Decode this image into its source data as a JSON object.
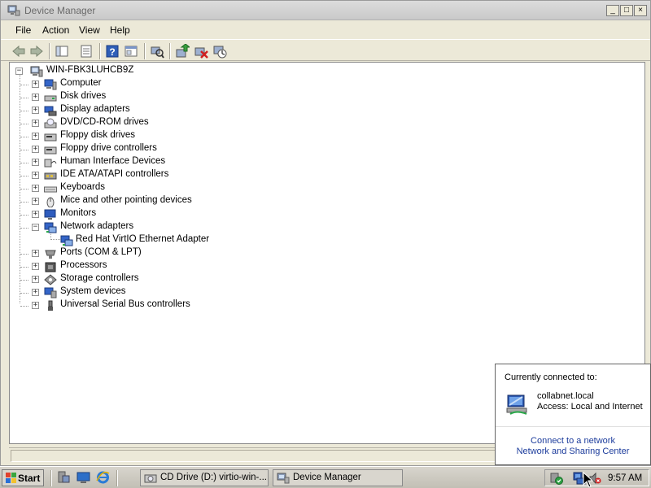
{
  "window": {
    "title": "Device Manager",
    "buttons": {
      "minimize": "_",
      "maximize": "□",
      "close": "×"
    }
  },
  "menu": [
    "File",
    "Action",
    "View",
    "Help"
  ],
  "toolbar": [
    "back-icon",
    "forward-icon",
    "console-tree-icon",
    "properties-icon",
    "help-icon",
    "console-icon",
    "scan-hardware-icon",
    "update-driver-icon",
    "uninstall-icon",
    "disable-icon"
  ],
  "tree": {
    "root": "WIN-FBK3LUHCB9Z",
    "categories": [
      {
        "label": "Computer",
        "icon": "computer-icon",
        "expanded": false
      },
      {
        "label": "Disk drives",
        "icon": "disk-drive-icon",
        "expanded": false
      },
      {
        "label": "Display adapters",
        "icon": "display-adapter-icon",
        "expanded": false
      },
      {
        "label": "DVD/CD-ROM drives",
        "icon": "dvd-drive-icon",
        "expanded": false
      },
      {
        "label": "Floppy disk drives",
        "icon": "floppy-disk-icon",
        "expanded": false
      },
      {
        "label": "Floppy drive controllers",
        "icon": "floppy-controller-icon",
        "expanded": false
      },
      {
        "label": "Human Interface Devices",
        "icon": "hid-icon",
        "expanded": false
      },
      {
        "label": "IDE ATA/ATAPI controllers",
        "icon": "ide-controller-icon",
        "expanded": false
      },
      {
        "label": "Keyboards",
        "icon": "keyboard-icon",
        "expanded": false
      },
      {
        "label": "Mice and other pointing devices",
        "icon": "mouse-icon",
        "expanded": false
      },
      {
        "label": "Monitors",
        "icon": "monitor-icon",
        "expanded": false
      },
      {
        "label": "Network adapters",
        "icon": "network-adapter-icon",
        "expanded": true,
        "children": [
          "Red Hat VirtIO Ethernet Adapter"
        ]
      },
      {
        "label": "Ports (COM & LPT)",
        "icon": "port-icon",
        "expanded": false
      },
      {
        "label": "Processors",
        "icon": "processor-icon",
        "expanded": false
      },
      {
        "label": "Storage controllers",
        "icon": "storage-controller-icon",
        "expanded": false
      },
      {
        "label": "System devices",
        "icon": "system-device-icon",
        "expanded": false
      },
      {
        "label": "Universal Serial Bus controllers",
        "icon": "usb-icon",
        "expanded": false
      }
    ]
  },
  "balloon": {
    "heading": "Currently connected to:",
    "network_name": "collabnet.local",
    "access": "Access:  Local and Internet",
    "link_connect": "Connect to a network",
    "link_center": "Network and Sharing Center"
  },
  "taskbar": {
    "start_label": "Start",
    "tasks": [
      "CD Drive (D:) virtio-win-...",
      "Device Manager"
    ],
    "clock": "9:57 AM"
  },
  "colors": {
    "link": "#1c3c9c",
    "tree_bg": "#ffffff",
    "chrome": "#ece9d8"
  }
}
